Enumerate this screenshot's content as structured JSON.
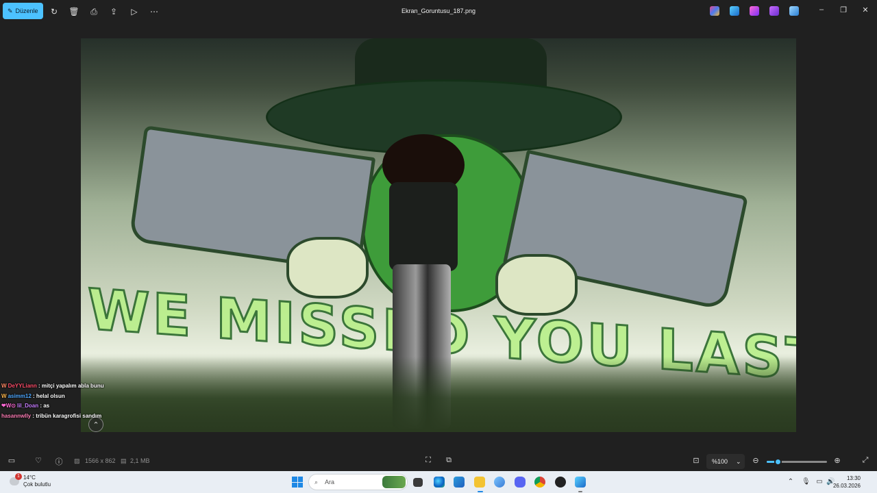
{
  "toolbar": {
    "edit_label": "Düzenle",
    "file_name": "Ekran_Goruntusu_187.png"
  },
  "photo": {
    "mural_text": "WE MISSED YOU LAST TIME"
  },
  "chat": [
    {
      "user": "DeYYLiann",
      "message": ": mitçi yapalım abla bunu",
      "user_color": "#ff4d6a"
    },
    {
      "user": "asimm12",
      "message": ": helal olsun",
      "user_color": "#4ea8ff"
    },
    {
      "user": "lil_Doan",
      "message": ": as",
      "user_color": "#c77dff"
    },
    {
      "user": "hasannwlly",
      "message": ": tribün karagrofisi sandım",
      "user_color": "#ff7eb6"
    }
  ],
  "bottombar": {
    "dimensions": "1566 x 862",
    "file_size": "2,1 MB",
    "zoom_value": "%100",
    "zoom_fraction": 0.18
  },
  "taskbar": {
    "temperature": "14°C",
    "weather": "Çok bulutlu",
    "weather_badge": "1",
    "search_placeholder": "Ara",
    "time": "13:30",
    "date": "26.03.2026"
  },
  "colors": {
    "accent": "#4cc2ff",
    "background": "#202020",
    "taskbar": "#e9eef4"
  }
}
